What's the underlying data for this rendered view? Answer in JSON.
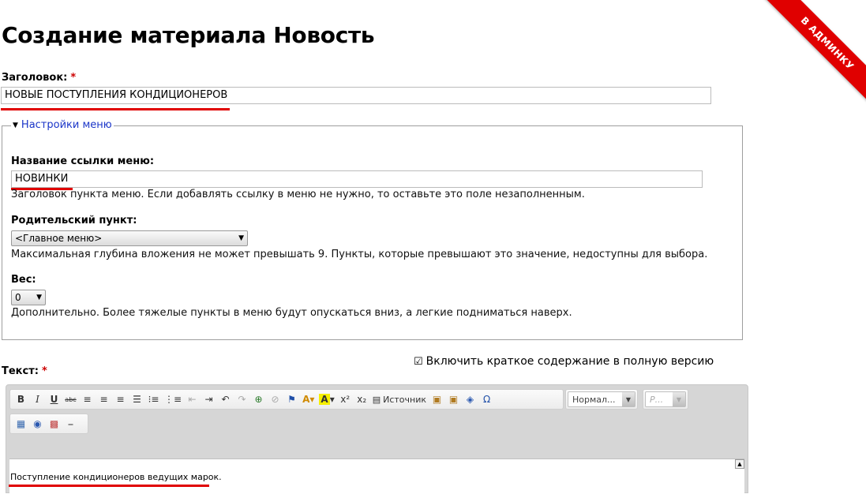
{
  "page": {
    "title": "Создание материала Новость"
  },
  "ribbon": {
    "label": "В АДМИНКУ"
  },
  "title_field": {
    "label": "Заголовок:",
    "required_mark": "*",
    "value": "НОВЫЕ ПОСТУПЛЕНИЯ КОНДИЦИОНЕРОВ"
  },
  "menu_settings": {
    "legend": "Настройки меню",
    "link_title": {
      "label": "Название ссылки меню:",
      "value": "НОВИНКИ",
      "description": "Заголовок пункта меню. Если добавлять ссылку в меню не нужно, то оставьте это поле незаполненным."
    },
    "parent": {
      "label": "Родительский пункт:",
      "value": "<Главное меню>",
      "description": "Максимальная глубина вложения не может превышать 9. Пункты, которые превышают это значение, недоступны для выбора."
    },
    "weight": {
      "label": "Вес:",
      "value": "0",
      "description": "Дополнительно. Более тяжелые пункты в меню будут опускаться вниз, а легкие подниматься наверх."
    }
  },
  "body_field": {
    "label": "Текст:",
    "required_mark": "*",
    "summary_toggle": "Включить краткое содержание в полную версию",
    "content": "Поступление кондиционеров ведущих марок."
  },
  "toolbar": {
    "bold": "B",
    "italic": "I",
    "underline": "U",
    "strike": "abc",
    "superscript": "x²",
    "subscript": "x₂",
    "source": "Источник",
    "format_combo": "Нормал...",
    "font_combo": "Р...",
    "text_color": "A",
    "bg_color": "A",
    "special_char": "Ω"
  },
  "colors": {
    "accent_red": "#e00000",
    "link_blue": "#1a35c8"
  }
}
